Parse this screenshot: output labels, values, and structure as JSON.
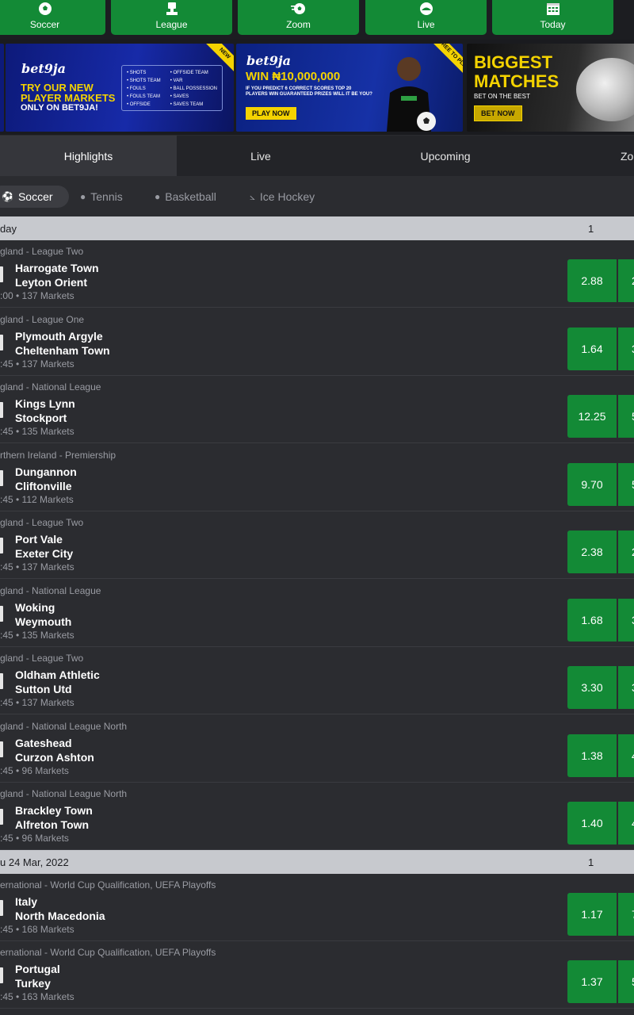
{
  "nav": {
    "items": [
      {
        "label": "Soccer",
        "icon": "soccer-ball-icon"
      },
      {
        "label": "League",
        "icon": "trophy-icon"
      },
      {
        "label": "Zoom",
        "icon": "zoom-ball-icon"
      },
      {
        "label": "Live",
        "icon": "live-icon"
      },
      {
        "label": "Today",
        "icon": "calendar-icon"
      }
    ]
  },
  "banners": {
    "b1": {
      "logo": "bet9ja",
      "ribbon": "NEW",
      "headline": "TRY OUR NEW PLAYER MARKETS",
      "sub": "ONLY ON BET9JA!",
      "list": [
        "• SHOTS",
        "• OFFSIDE TEAM",
        "• SHOTS TEAM",
        "• VAR",
        "• FOULS",
        "• BALL POSSESSION",
        "• FOULS TEAM",
        "• SAVES",
        "• OFFSIDE",
        "• SAVES TEAM"
      ]
    },
    "b2": {
      "logo": "bet9ja",
      "ribbon": "FREE TO PLAY",
      "headline": "WIN ₦10,000,000",
      "sub": "IF YOU PREDICT 6 CORRECT SCORES TOP 20 PLAYERS WIN GUARANTEED PRIZES WILL IT BE YOU?",
      "cta": "PLAY NOW"
    },
    "b3": {
      "headline": "BIGGEST MATCHES",
      "sub": "BET ON THE BEST",
      "cta": "BET NOW"
    }
  },
  "tabs": [
    "Highlights",
    "Live",
    "Upcoming",
    "Zo"
  ],
  "sports": [
    "Soccer",
    "Tennis",
    "Basketball",
    "Ice Hockey"
  ],
  "sections": [
    {
      "date": "day",
      "col1": "1",
      "matches": [
        {
          "league": "gland - League Two",
          "home": "Harrogate Town",
          "away": "Leyton Orient",
          "meta": ":00 • 137 Markets",
          "odd1": "2.88",
          "odd2": "2"
        },
        {
          "league": "gland - League One",
          "home": "Plymouth Argyle",
          "away": "Cheltenham Town",
          "meta": ":45 • 137 Markets",
          "odd1": "1.64",
          "odd2": "3"
        },
        {
          "league": "gland - National League",
          "home": "Kings Lynn",
          "away": "Stockport",
          "meta": ":45 • 135 Markets",
          "odd1": "12.25",
          "odd2": "5"
        },
        {
          "league": "rthern Ireland - Premiership",
          "home": "Dungannon",
          "away": "Cliftonville",
          "meta": ":45 • 112 Markets",
          "odd1": "9.70",
          "odd2": "5"
        },
        {
          "league": "gland - League Two",
          "home": "Port Vale",
          "away": "Exeter City",
          "meta": ":45 • 137 Markets",
          "odd1": "2.38",
          "odd2": "2"
        },
        {
          "league": "gland - National League",
          "home": "Woking",
          "away": "Weymouth",
          "meta": ":45 • 135 Markets",
          "odd1": "1.68",
          "odd2": "3"
        },
        {
          "league": "gland - League Two",
          "home": "Oldham Athletic",
          "away": "Sutton Utd",
          "meta": ":45 • 137 Markets",
          "odd1": "3.30",
          "odd2": "3"
        },
        {
          "league": "gland - National League North",
          "home": "Gateshead",
          "away": "Curzon Ashton",
          "meta": ":45 • 96 Markets",
          "odd1": "1.38",
          "odd2": "4"
        },
        {
          "league": "gland - National League North",
          "home": "Brackley Town",
          "away": "Alfreton Town",
          "meta": ":45 • 96 Markets",
          "odd1": "1.40",
          "odd2": "4"
        }
      ]
    },
    {
      "date": "u 24 Mar, 2022",
      "col1": "1",
      "matches": [
        {
          "league": "ernational - World Cup Qualification, UEFA Playoffs",
          "home": "Italy",
          "away": "North Macedonia",
          "meta": ":45 • 168 Markets",
          "odd1": "1.17",
          "odd2": "7"
        },
        {
          "league": "ernational - World Cup Qualification, UEFA Playoffs",
          "home": "Portugal",
          "away": "Turkey",
          "meta": ":45 • 163 Markets",
          "odd1": "1.37",
          "odd2": "5"
        }
      ]
    }
  ],
  "colors": {
    "green": "#138a36",
    "background": "#2b2c30",
    "header_bar": "#c7c9ce",
    "muted_text": "#9a9ca3",
    "banner_yellow": "#f4d300"
  }
}
